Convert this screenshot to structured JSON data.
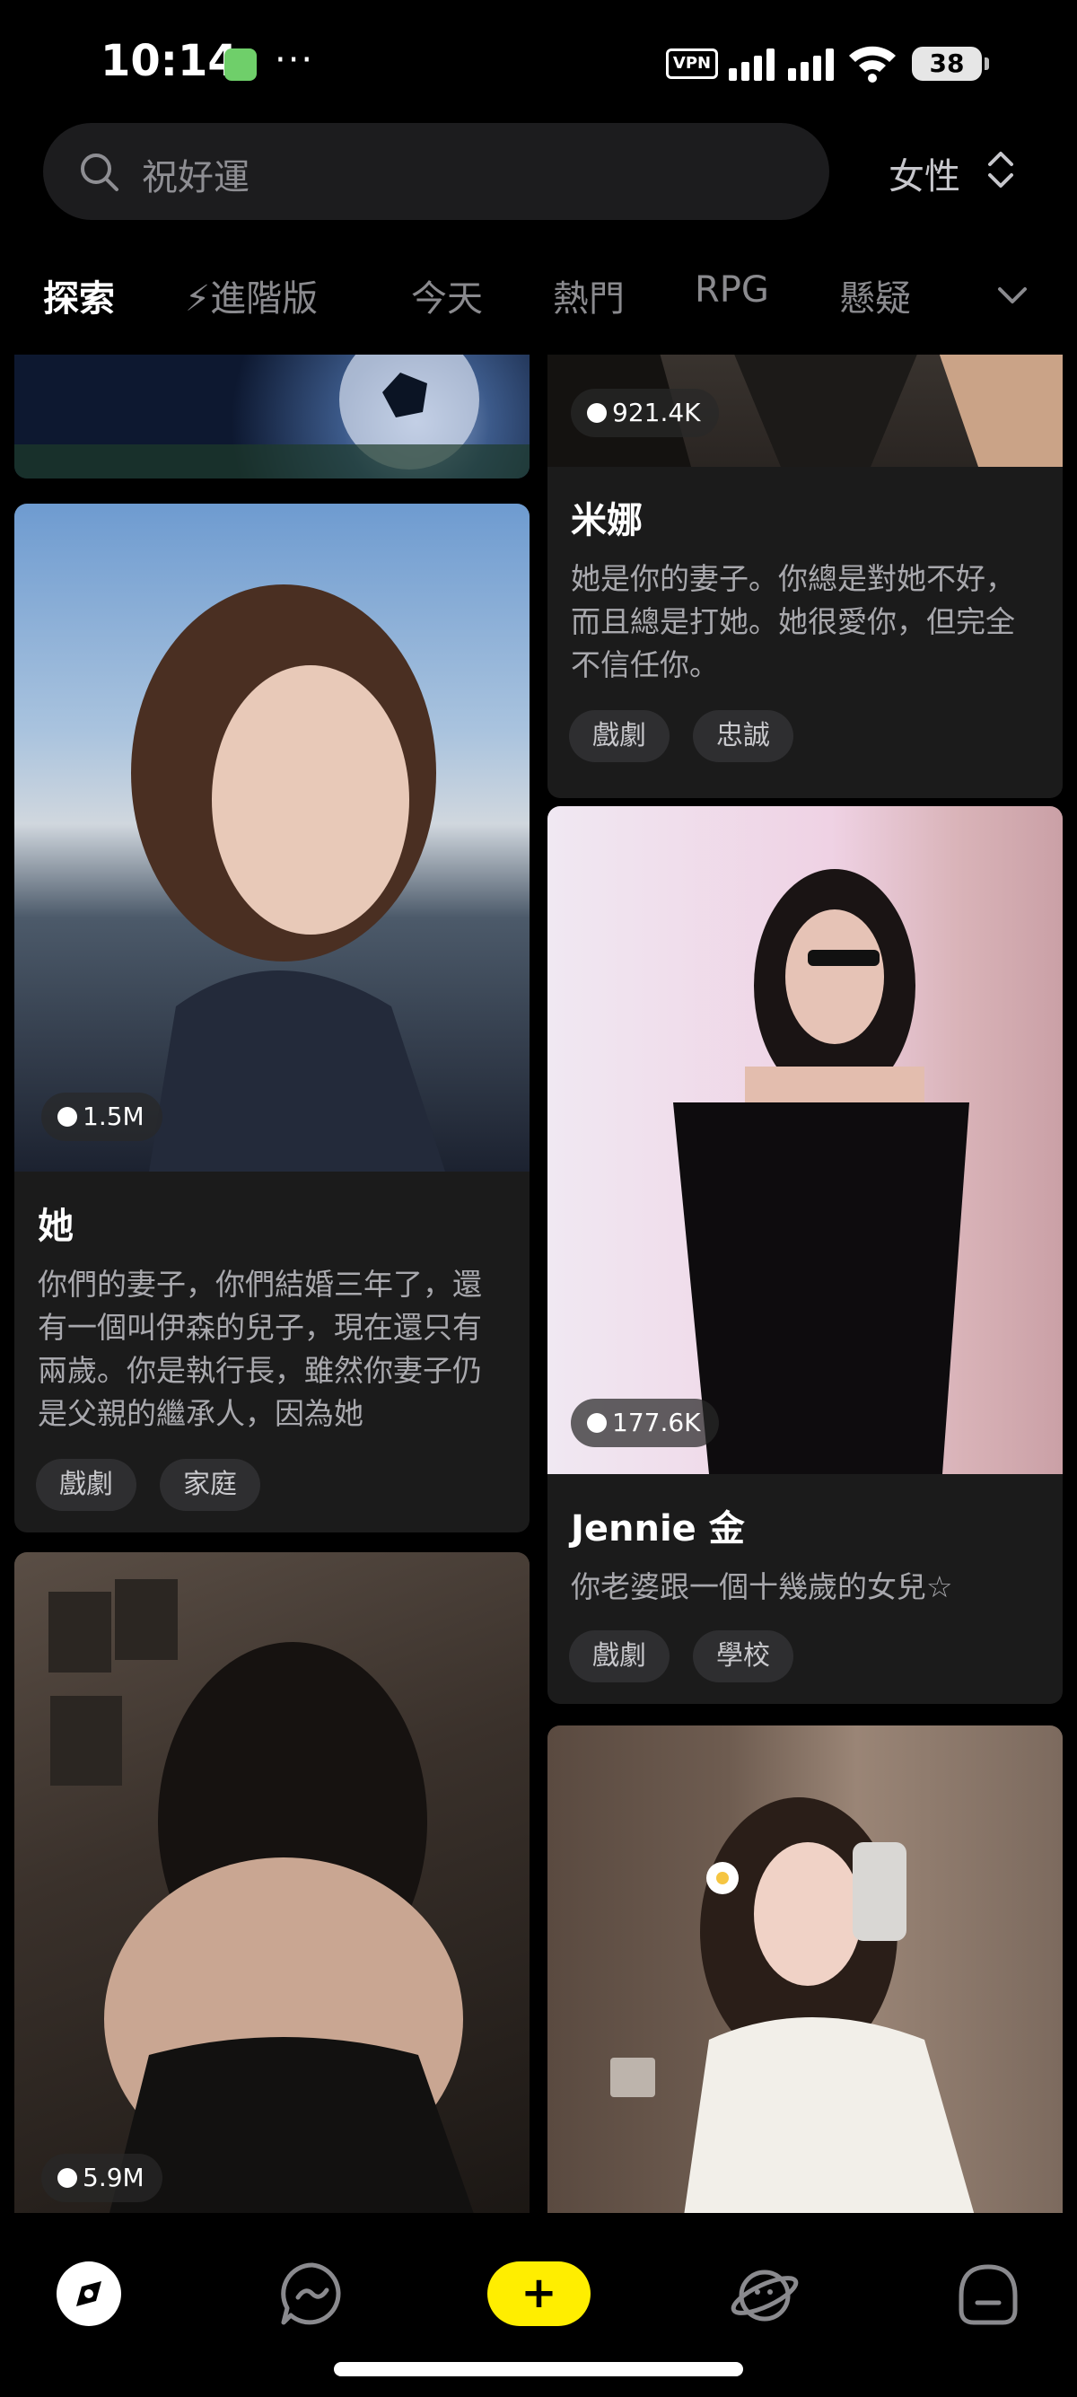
{
  "status_bar": {
    "time": "10:14",
    "more_indicator": "···",
    "vpn_label": "VPN",
    "battery": "38"
  },
  "search": {
    "placeholder": "祝好運",
    "gender_filter": "女性"
  },
  "tabs": [
    {
      "label": "探索",
      "active": true
    },
    {
      "label": "⚡進階版",
      "active": false
    },
    {
      "label": "今天",
      "active": false
    },
    {
      "label": "熱門",
      "active": false
    },
    {
      "label": "RPG",
      "active": false
    },
    {
      "label": "懸疑",
      "active": false
    }
  ],
  "cards": {
    "left_top": {},
    "left_1": {
      "count": "1.5M",
      "title": "她",
      "description": "你們的妻子，你們結婚三年了，還有一個叫伊森的兒子，現在還只有兩歲。你是執行長，雖然你妻子仍是父親的繼承人，因為她",
      "tags": [
        "戲劇",
        "家庭"
      ]
    },
    "left_2": {
      "count": "5.9M"
    },
    "right_1": {
      "count": "921.4K",
      "title": "米娜",
      "description": "她是你的妻子。你總是對她不好，而且總是打她。她很愛你，但完全不信任你。",
      "tags": [
        "戲劇",
        "忠誠"
      ]
    },
    "right_2": {
      "count": "177.6K",
      "title": "Jennie 金",
      "description": "你老婆跟一個十幾歲的女兒☆",
      "tags": [
        "戲劇",
        "學校"
      ]
    },
    "right_3": {}
  },
  "bottom_nav": {
    "add_label": "+"
  },
  "colors": {
    "background": "#000000",
    "card": "#1b1b1b",
    "accent_yellow": "#ffee00",
    "muted_text": "#a8a8ad"
  }
}
